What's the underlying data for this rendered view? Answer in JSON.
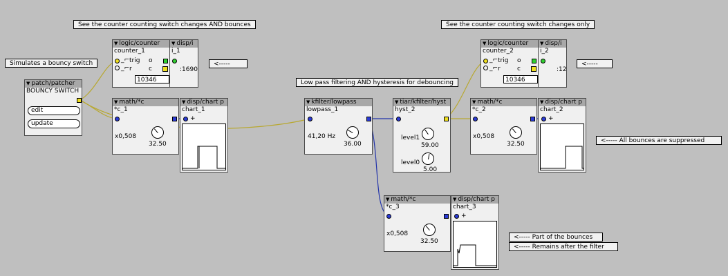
{
  "comments": {
    "bounces_and_changes": "See the counter counting switch changes AND bounces",
    "changes_only": "See the counter counting switch changes only",
    "bouncy_switch": "Simulates a bouncy switch",
    "arrow1": "<-----",
    "arrow2": "<-----",
    "lowpass": "Low pass filtering AND hysteresis for debouncing",
    "suppressed": "<----- All bounces are suppressed",
    "part_bounces": "<----- Part of the bounces",
    "remains": "<----- Remains after the filter"
  },
  "patcher": {
    "type": "patch/patcher",
    "name": "BOUNCY SWITCH",
    "edit": "edit",
    "update": "update"
  },
  "counter1": {
    "type": "logic/counter",
    "name": "counter_1",
    "trig": "trig",
    "o": "o",
    "r": "r",
    "c": "c",
    "value": "10346"
  },
  "disp_i1": {
    "type": "disp/i",
    "name": "i_1",
    "value": ":1690"
  },
  "counter2": {
    "type": "logic/counter",
    "name": "counter_2",
    "trig": "trig",
    "o": "o",
    "r": "r",
    "c": "c",
    "value": "10346"
  },
  "disp_i2": {
    "type": "disp/i",
    "name": "i_2",
    "value": ":12"
  },
  "math1": {
    "type": "math/*c",
    "name": "*c_1",
    "factor": "x0,508",
    "knob": "32.50"
  },
  "chart1": {
    "type": "disp/chart p",
    "name": "chart_1",
    "plus": "+"
  },
  "lowpass": {
    "type": "kfilter/lowpass",
    "name": "lowpass_1",
    "freq": "41,20 Hz",
    "knob": "36.00"
  },
  "hyst": {
    "type": "tiar/kfilter/hyst",
    "name": "hyst_2",
    "level1_label": "level1",
    "level1": "59.00",
    "level0_label": "level0",
    "level0": "5.00"
  },
  "math2": {
    "type": "math/*c",
    "name": "*c_2",
    "factor": "x0,508",
    "knob": "32.50"
  },
  "chart2": {
    "type": "disp/chart p",
    "name": "chart_2",
    "plus": "+"
  },
  "math3": {
    "type": "math/*c",
    "name": "*c_3",
    "factor": "x0,508",
    "knob": "32.50"
  },
  "chart3": {
    "type": "disp/chart p",
    "name": "chart_3",
    "plus": "+"
  },
  "colors": {
    "background": "#bfbfbf",
    "wire_yellow": "#b8a830",
    "wire_blue": "#2233aa",
    "header": "#a8a8a8"
  }
}
